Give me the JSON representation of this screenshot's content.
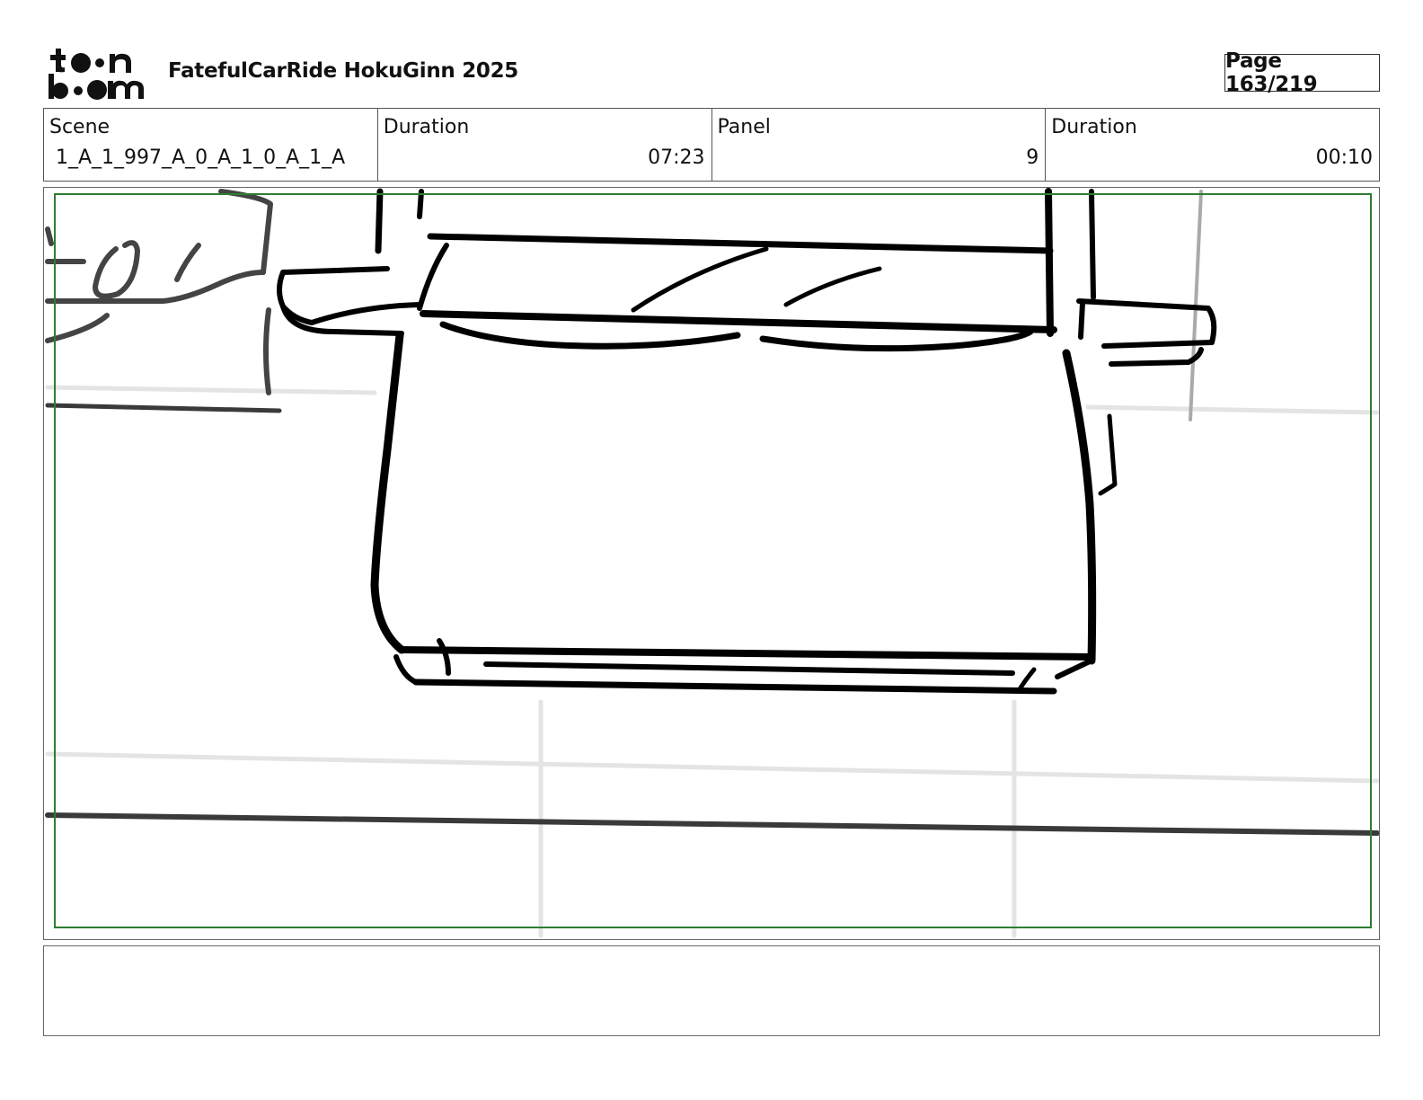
{
  "header": {
    "logo_text": "toon boom",
    "project_title": "FatefulCarRide HokuGinn 2025",
    "page_label": "Page 163/219"
  },
  "info": {
    "scene_label": "Scene",
    "scene_value": "1_A_1_997_A_0_A_1_0_A_1_A",
    "scene_duration_label": "Duration",
    "scene_duration_value": "07:23",
    "panel_label": "Panel",
    "panel_value": "9",
    "panel_duration_label": "Duration",
    "panel_duration_value": "00:10"
  },
  "panel": {
    "safe_frame_color": "#2e7d32",
    "sketch_color": "#000000"
  },
  "notes": {
    "text": ""
  }
}
